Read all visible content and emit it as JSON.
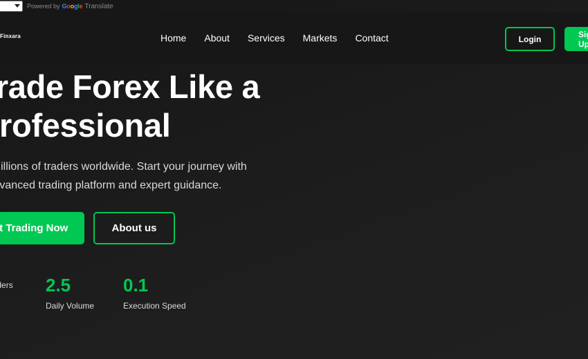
{
  "translate": {
    "powered_by": "Powered by",
    "google": [
      "G",
      "o",
      "o",
      "g",
      "l",
      "e"
    ],
    "translate_label": "Translate"
  },
  "header": {
    "logo_text": "Finxara",
    "nav": [
      "Home",
      "About",
      "Services",
      "Markets",
      "Contact"
    ],
    "login_label": "Login",
    "signup_label": "Sign Up"
  },
  "hero": {
    "title_line1": "Trade Forex Like a",
    "title_line2": "Professional",
    "subtitle_line1": "Join millions of traders worldwide. Start your journey with",
    "subtitle_line2": "our advanced trading platform and expert guidance.",
    "primary_cta": "Start Trading Now",
    "secondary_cta": "About us"
  },
  "stats": [
    {
      "value": "",
      "label": "Active Traders"
    },
    {
      "value": "2.5",
      "label": "Daily Volume"
    },
    {
      "value": "0.1",
      "label": "Execution Speed"
    }
  ],
  "colors": {
    "accent": "#00c853",
    "background": "#1b1b1b",
    "header_bg": "#171717"
  }
}
